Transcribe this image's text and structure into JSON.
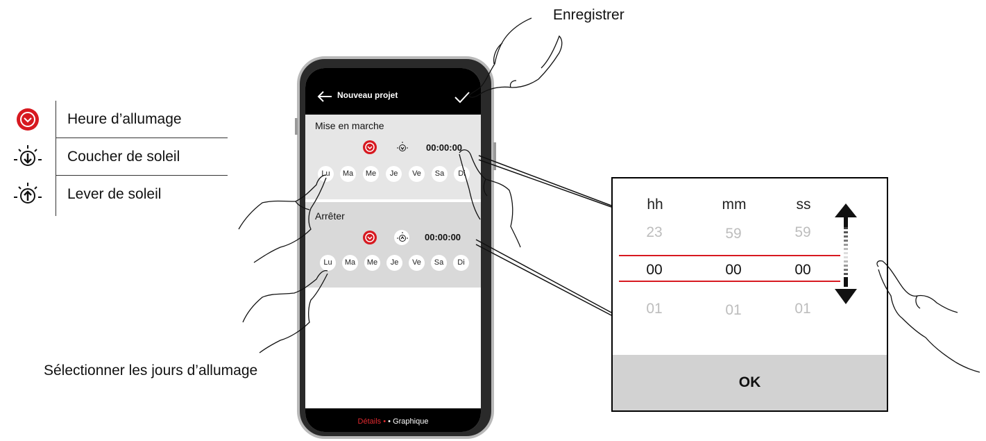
{
  "legend": {
    "items": [
      {
        "icon": "clock-icon",
        "label": "Heure d’allumage"
      },
      {
        "icon": "sunset-icon",
        "label": "Coucher de soleil"
      },
      {
        "icon": "sunrise-icon",
        "label": "Lever de soleil"
      }
    ]
  },
  "callouts": {
    "save": "Enregistrer",
    "select_days": "Sélectionner les jours d’allumage"
  },
  "app": {
    "back_icon": "arrow-left-icon",
    "title": "Nouveau projet",
    "confirm_icon": "checkmark-icon",
    "start_section": {
      "label": "Mise en marche",
      "time": "00:00:00",
      "days": [
        "Lu",
        "Ma",
        "Me",
        "Je",
        "Ve",
        "Sa",
        "Di"
      ]
    },
    "stop_section": {
      "label": "Arrêter",
      "time": "00:00:00",
      "days": [
        "Lu",
        "Ma",
        "Me",
        "Je",
        "Ve",
        "Sa",
        "Di"
      ]
    },
    "bottom_tabs": {
      "details": "Détails",
      "separator": "•",
      "graph": "• Graphique"
    }
  },
  "picker": {
    "headers": [
      "hh",
      "mm",
      "ss"
    ],
    "above": [
      "23",
      "59",
      "59"
    ],
    "selected": [
      "00",
      "00",
      "00"
    ],
    "below": [
      "01",
      "01",
      "01"
    ],
    "ok": "OK"
  },
  "colors": {
    "accent_red": "#d71920",
    "section_gray": "#e6e6e6",
    "ok_gray": "#d2d2d2"
  }
}
